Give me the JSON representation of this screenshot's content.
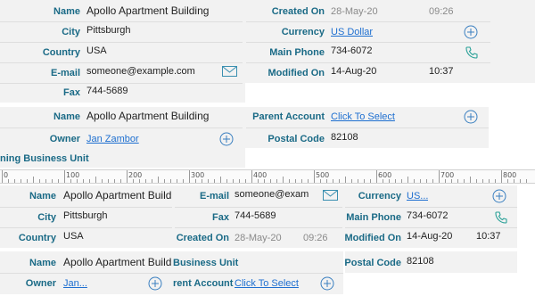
{
  "top": {
    "name_label": "Name",
    "name_value": "Apollo Apartment Building",
    "city_label": "City",
    "city_value": "Pittsburgh",
    "country_label": "Country",
    "country_value": "USA",
    "email_label": "E-mail",
    "email_value": "someone@example.com",
    "fax_label": "Fax",
    "fax_value": "744-5689",
    "created_label": "Created On",
    "created_date": "28-May-20",
    "created_time": "09:26",
    "currency_label": "Currency",
    "currency_value": "US Dollar",
    "phone_label": "Main Phone",
    "phone_value": "734-6072",
    "modified_label": "Modified On",
    "modified_date": "14-Aug-20",
    "modified_time": "10:37"
  },
  "second": {
    "name_label": "Name",
    "name_value": "Apollo Apartment Building",
    "owner_label": "Owner",
    "owner_value": "Jan Zambor",
    "parent_label": "Parent Account",
    "parent_value": "Click To Select",
    "postal_label": "Postal Code",
    "postal_value": "82108",
    "bu_label": "ning Business Unit"
  },
  "ruler": {
    "labels": [
      "0",
      "100",
      "200",
      "300",
      "400",
      "500",
      "600",
      "700",
      "800"
    ]
  },
  "narrow": {
    "name_label": "Name",
    "name_value": "Apollo Apartment Buildir",
    "city_label": "City",
    "city_value": "Pittsburgh",
    "country_label": "Country",
    "country_value": "USA",
    "email_label": "E-mail",
    "email_value": "someone@exam",
    "fax_label": "Fax",
    "fax_value": "744-5689",
    "created_label": "Created On",
    "created_date": "28-May-20",
    "created_time": "09:26",
    "currency_label": "Currency",
    "currency_value": "US...",
    "phone_label": "Main Phone",
    "phone_value": "734-6072",
    "modified_label": "Modified On",
    "modified_date": "14-Aug-20",
    "modified_time": "10:37",
    "name2_label": "Name",
    "name2_value": "Apollo Apartment Buildir",
    "bu_label": "Business Unit",
    "postal_label": "Postal Code",
    "postal_value": "82108",
    "owner_label": "Owner",
    "owner_value": "Jan...",
    "parent_label": "rent Account",
    "parent_value": "Click To Select"
  },
  "icons": {
    "mail": "mail-icon",
    "phone": "phone-icon",
    "add": "add-circle-icon"
  },
  "colors": {
    "label": "#1a6a86",
    "link": "#1e6fd0",
    "icon": "#3a8fb0",
    "phone": "#2aa198"
  }
}
